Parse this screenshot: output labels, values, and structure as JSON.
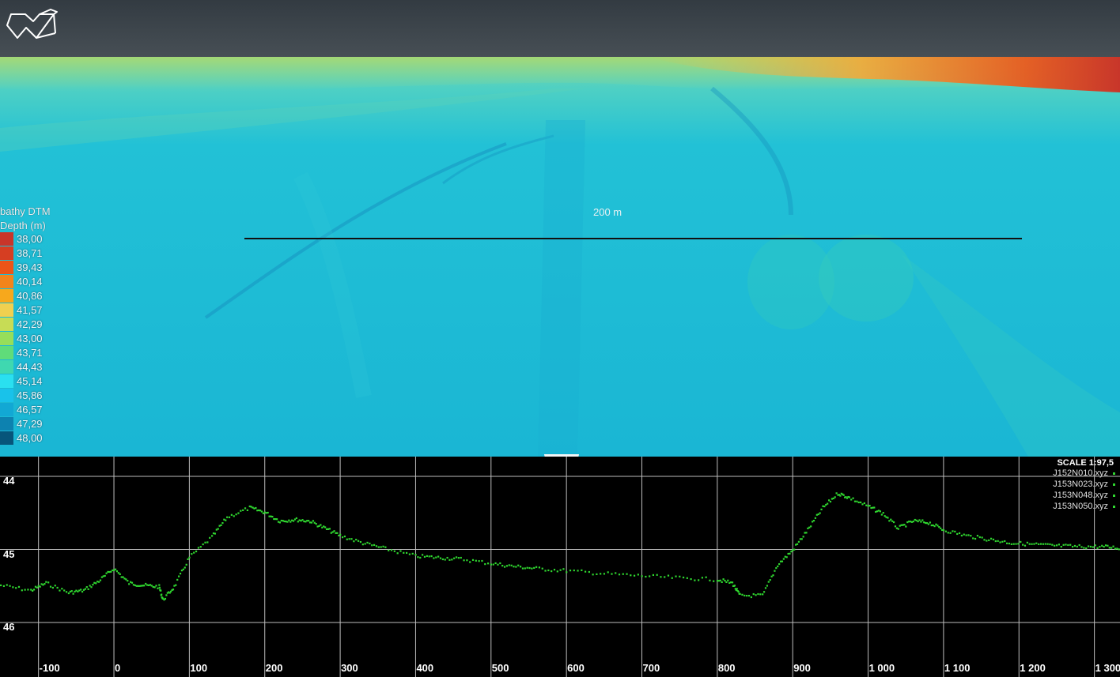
{
  "legend": {
    "title": "bathy DTM",
    "subtitle": "Depth (m)",
    "items": [
      {
        "label": "38,00",
        "color": "#c8352a"
      },
      {
        "label": "38,71",
        "color": "#d63e22"
      },
      {
        "label": "39,43",
        "color": "#ec5518"
      },
      {
        "label": "40,14",
        "color": "#f2841c"
      },
      {
        "label": "40,86",
        "color": "#f7a81c"
      },
      {
        "label": "41,57",
        "color": "#f0d050"
      },
      {
        "label": "42,29",
        "color": "#c7dc55"
      },
      {
        "label": "43,00",
        "color": "#96de5a"
      },
      {
        "label": "43,71",
        "color": "#5fdc7a"
      },
      {
        "label": "44,43",
        "color": "#3fd8b0"
      },
      {
        "label": "45,14",
        "color": "#2ae0f0"
      },
      {
        "label": "45,86",
        "color": "#19c2ea"
      },
      {
        "label": "46,57",
        "color": "#12a8d4"
      },
      {
        "label": "47,29",
        "color": "#0d82b0"
      },
      {
        "label": "48,00",
        "color": "#07557a"
      }
    ]
  },
  "scalebar": {
    "label": "200 m"
  },
  "profile": {
    "scale": "SCALE 1:97,5",
    "files": [
      "J152N010.xyz",
      "J153N023.xyz",
      "J153N048.xyz",
      "J153N050.xyz"
    ],
    "series_color": "#2fd62f",
    "y_ticks": [
      "44",
      "45",
      "46"
    ],
    "x_ticks": [
      "-100",
      "0",
      "100",
      "200",
      "300",
      "400",
      "500",
      "600",
      "700",
      "800",
      "900",
      "1 000",
      "1 100",
      "1 200",
      "1 300"
    ]
  },
  "chart_data": {
    "type": "scatter",
    "xlim": [
      -150,
      1335
    ],
    "ylim": [
      46.6,
      43.95
    ],
    "y_inverted": true,
    "x": [
      -150,
      -110,
      -90,
      -60,
      -40,
      -20,
      0,
      20,
      40,
      60,
      65,
      80,
      100,
      130,
      150,
      180,
      200,
      220,
      240,
      260,
      280,
      300,
      330,
      360,
      400,
      430,
      460,
      500,
      530,
      560,
      600,
      650,
      700,
      750,
      800,
      820,
      830,
      860,
      880,
      900,
      920,
      940,
      960,
      975,
      1000,
      1020,
      1040,
      1060,
      1080,
      1100,
      1130,
      1160,
      1190,
      1220,
      1250,
      1280,
      1310,
      1335
    ],
    "y": [
      45.48,
      45.55,
      45.45,
      45.58,
      45.55,
      45.42,
      45.25,
      45.45,
      45.48,
      45.5,
      45.68,
      45.5,
      45.1,
      44.82,
      44.55,
      44.42,
      44.48,
      44.6,
      44.58,
      44.6,
      44.7,
      44.8,
      44.9,
      44.98,
      45.08,
      45.1,
      45.12,
      45.18,
      45.22,
      45.25,
      45.28,
      45.32,
      45.35,
      45.38,
      45.4,
      45.45,
      45.62,
      45.62,
      45.2,
      45.0,
      44.72,
      44.42,
      44.22,
      44.28,
      44.4,
      44.5,
      44.7,
      44.6,
      44.62,
      44.72,
      44.8,
      44.85,
      44.9,
      44.92,
      44.94,
      44.95,
      44.95,
      44.97
    ]
  }
}
